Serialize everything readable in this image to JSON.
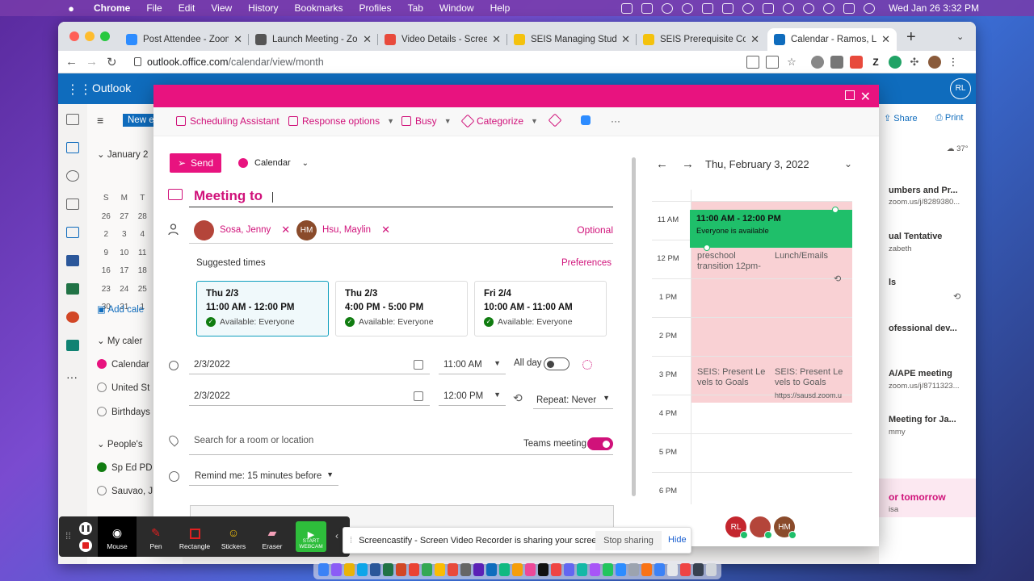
{
  "menubar": {
    "app": "Chrome",
    "items": [
      "File",
      "Edit",
      "View",
      "History",
      "Bookmarks",
      "Profiles",
      "Tab",
      "Window",
      "Help"
    ],
    "clock": "Wed Jan 26  3:32 PM"
  },
  "tabs": [
    {
      "label": "Post Attendee - Zoom",
      "color": "#2d8cff"
    },
    {
      "label": "Launch Meeting - Zoom",
      "color": "#555555"
    },
    {
      "label": "Video Details - Screencastify",
      "color": "#e84a3c"
    },
    {
      "label": "SEIS Managing Students",
      "color": "#f4c20d"
    },
    {
      "label": "SEIS Prerequisite Course",
      "color": "#f4c20d"
    },
    {
      "label": "Calendar - Ramos, Lisa",
      "color": "#0f6cbd"
    }
  ],
  "address": {
    "host": "outlook.office.com",
    "path": "/calendar/view/month",
    "profile_letter": "Z"
  },
  "outlook": {
    "app_name": "Outlook",
    "avatar": "RL",
    "new_event": "New ev",
    "month": "January 2",
    "weekdays": [
      "S",
      "M",
      "T"
    ],
    "mini_rows": [
      [
        "26",
        "27",
        "28"
      ],
      [
        "2",
        "3",
        "4"
      ],
      [
        "9",
        "10",
        "11"
      ],
      [
        "16",
        "17",
        "18"
      ],
      [
        "23",
        "24",
        "25"
      ],
      [
        "30",
        "31",
        "1"
      ]
    ],
    "add_calendar": "Add cale",
    "my_calendars": "My caler",
    "calendars": [
      "Calendar",
      "United St",
      "Birthdays"
    ],
    "peoples": "People's",
    "people_cals": [
      "Sp Ed PD",
      "Sauvao, J"
    ],
    "share": "Share",
    "print": "Print",
    "weather": "37°",
    "agenda": [
      {
        "title": "umbers and Pr...",
        "sub": "zoom.us/j/8289380..."
      },
      {
        "title": "ual Tentative",
        "sub": "zabeth"
      },
      {
        "title": "ls",
        "sub": ""
      },
      {
        "title": "ofessional dev...",
        "sub": ""
      },
      {
        "title": "A/APE meeting",
        "sub": "zoom.us/j/8711323..."
      },
      {
        "title": "Meeting for Ja...",
        "sub": "mmy"
      },
      {
        "title": "or tomorrow",
        "sub": "isa"
      }
    ]
  },
  "toolbar": {
    "scheduling": "Scheduling Assistant",
    "response": "Response options",
    "busy": "Busy",
    "categorize": "Categorize",
    "more": "···"
  },
  "form": {
    "send": "Send",
    "calendar": "Calendar",
    "title": "Meeting to",
    "attendees": [
      {
        "name": "Sosa, Jenny",
        "initials": "",
        "color": "#b4453a"
      },
      {
        "name": "Hsu, Maylin",
        "initials": "HM",
        "color": "#8a4b2b"
      }
    ],
    "optional": "Optional",
    "suggested_label": "Suggested times",
    "preferences": "Preferences",
    "suggestions": [
      {
        "date": "Thu 2/3",
        "time": "11:00 AM - 12:00 PM",
        "avail": "Available: Everyone"
      },
      {
        "date": "Thu 2/3",
        "time": "4:00 PM - 5:00 PM",
        "avail": "Available: Everyone"
      },
      {
        "date": "Fri 2/4",
        "time": "10:00 AM - 11:00 AM",
        "avail": "Available: Everyone"
      }
    ],
    "start_date": "2/3/2022",
    "start_time": "11:00 AM",
    "all_day": "All day",
    "end_date": "2/3/2022",
    "end_time": "12:00 PM",
    "repeat": "Repeat:  Never",
    "location_placeholder": "Search for a room or location",
    "teams": "Teams meeting",
    "remind": "Remind me:  15 minutes before"
  },
  "day": {
    "date": "Thu, February 3, 2022",
    "hours": [
      "11 AM",
      "12 PM",
      "1 PM",
      "2 PM",
      "3 PM",
      "4 PM",
      "5 PM",
      "6 PM"
    ],
    "new_event": {
      "time": "11:00 AM - 12:00 PM",
      "status": "Everyone is available"
    },
    "events": [
      {
        "title": "preschool transition 12pm-"
      },
      {
        "title": "Lunch/Emails"
      },
      {
        "title": "SEIS: Present Le vels to Goals"
      },
      {
        "title": "SEIS: Present Le vels to Goals",
        "sub": "https://sausd.zoom.u"
      }
    ],
    "avatars": [
      {
        "initials": "RL",
        "color": "#c4262e"
      },
      {
        "initials": "",
        "color": "#b4453a"
      },
      {
        "initials": "HM",
        "color": "#8a4b2b"
      }
    ]
  },
  "annotate": {
    "tools": [
      "Mouse",
      "Pen",
      "Rectangle",
      "Stickers",
      "Eraser"
    ],
    "start": "START WEBCAM"
  },
  "sharebar": {
    "message": "Screencastify - Screen Video Recorder is sharing your screen.",
    "stop": "Stop sharing",
    "hide": "Hide"
  },
  "colors": {
    "accent": "#e8137f",
    "brand": "#0f6cbd",
    "available": "#1fbf6a",
    "busy": "#f9d1d4"
  }
}
